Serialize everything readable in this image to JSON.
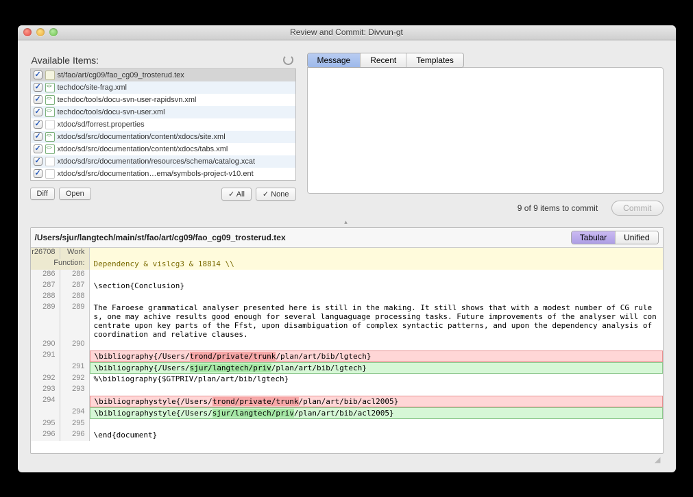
{
  "window": {
    "title": "Review and Commit: Divvun-gt"
  },
  "available": {
    "header": "Available Items:",
    "items": [
      {
        "name": "st/fao/art/cg09/fao_cg09_trosterud.tex",
        "type": "tex",
        "selected": true
      },
      {
        "name": "techdoc/site-frag.xml",
        "type": "xml"
      },
      {
        "name": "techdoc/tools/docu-svn-user-rapidsvn.xml",
        "type": "xml"
      },
      {
        "name": "techdoc/tools/docu-svn-user.xml",
        "type": "xml"
      },
      {
        "name": "xtdoc/sd/forrest.properties",
        "type": "plain"
      },
      {
        "name": "xtdoc/sd/src/documentation/content/xdocs/site.xml",
        "type": "xml"
      },
      {
        "name": "xtdoc/sd/src/documentation/content/xdocs/tabs.xml",
        "type": "xml"
      },
      {
        "name": "xtdoc/sd/src/documentation/resources/schema/catalog.xcat",
        "type": "plain"
      },
      {
        "name": "xtdoc/sd/src/documentation…ema/symbols-project-v10.ent",
        "type": "plain"
      }
    ]
  },
  "buttons": {
    "diff": "Diff",
    "open": "Open",
    "all": "✓ All",
    "none": "✓ None",
    "commit": "Commit"
  },
  "msg_tabs": {
    "message": "Message",
    "recent": "Recent",
    "templates": "Templates"
  },
  "status": "9 of 9 items to commit",
  "diff": {
    "path": "/Users/sjur/langtech/main/st/fao/art/cg09/fao_cg09_trosterud.tex",
    "view_tabular": "Tabular",
    "view_unified": "Unified",
    "col_rev": "r26708",
    "col_work": "Work",
    "func_label": "Function:",
    "func_line": "Dependency & vislcg3 & 18814 \\\\",
    "rows": [
      {
        "l": "286",
        "r": "286",
        "t": ""
      },
      {
        "l": "287",
        "r": "287",
        "t": "\\section{Conclusion}"
      },
      {
        "l": "288",
        "r": "288",
        "t": ""
      },
      {
        "l": "289",
        "r": "289",
        "t": "The Faroese grammatical analyser presented here is still in the making. It still shows that with a modest number of CG rules, one may achive results good enough for several languaguage processing tasks. Future improvements of the analyser will concentrate upon key parts of the Ffst, upon disambiguation of complex syntactic patterns, and upon the dependency analysis of coordination and relative clauses."
      },
      {
        "l": "290",
        "r": "290",
        "t": ""
      },
      {
        "l": "291",
        "r": "",
        "t": "\\bibliography{/Users/",
        "d": "del",
        "hl": "trond/private/trunk",
        "after": "/plan/art/bib/lgtech}"
      },
      {
        "l": "",
        "r": "291",
        "t": "\\bibliography{/Users/",
        "d": "add",
        "hl": "sjur/langtech/priv",
        "after": "/plan/art/bib/lgtech}"
      },
      {
        "l": "292",
        "r": "292",
        "t": "%\\bibliography{$GTPRIV/plan/art/bib/lgtech}"
      },
      {
        "l": "293",
        "r": "293",
        "t": ""
      },
      {
        "l": "294",
        "r": "",
        "t": "\\bibliographystyle{/Users/",
        "d": "del",
        "hl": "trond/private/trunk",
        "after": "/plan/art/bib/acl2005}"
      },
      {
        "l": "",
        "r": "294",
        "t": "\\bibliographystyle{/Users/",
        "d": "add",
        "hl": "sjur/langtech/priv",
        "after": "/plan/art/bib/acl2005}"
      },
      {
        "l": "295",
        "r": "295",
        "t": ""
      },
      {
        "l": "296",
        "r": "296",
        "t": "\\end{document}"
      }
    ]
  }
}
